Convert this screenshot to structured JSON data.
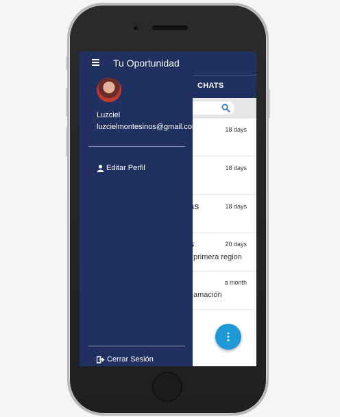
{
  "drawer": {
    "title": "Tu Oportunidad",
    "menu_icon": "hamburger-menu-icon",
    "user": {
      "name": "Luzciel",
      "email": "luzcielmontesinos@gmail.com",
      "avatar_icon": "user-avatar"
    },
    "items": [
      {
        "label": "Editar Perfil",
        "icon": "user-icon"
      }
    ],
    "logout": {
      "label": "Cerrar Sesión",
      "icon": "sign-out-icon"
    }
  },
  "tabs": {
    "chats_label": "CHATS"
  },
  "search": {
    "icon": "search-icon"
  },
  "list": [
    {
      "title": "",
      "subtitle": "",
      "time": "18 days"
    },
    {
      "title": "",
      "subtitle": "",
      "time": "18 days"
    },
    {
      "title": "as",
      "subtitle": "",
      "time": "18 days"
    },
    {
      "title": "s",
      "subtitle": "primera region",
      "time": "20 days"
    },
    {
      "title": "",
      "subtitle": "amación",
      "time": "a month"
    }
  ],
  "fab": {
    "icon": "more-vertical-icon"
  },
  "colors": {
    "primary": "#203060",
    "accent": "#1e9ad8",
    "search_strip": "#e6e6e6"
  }
}
